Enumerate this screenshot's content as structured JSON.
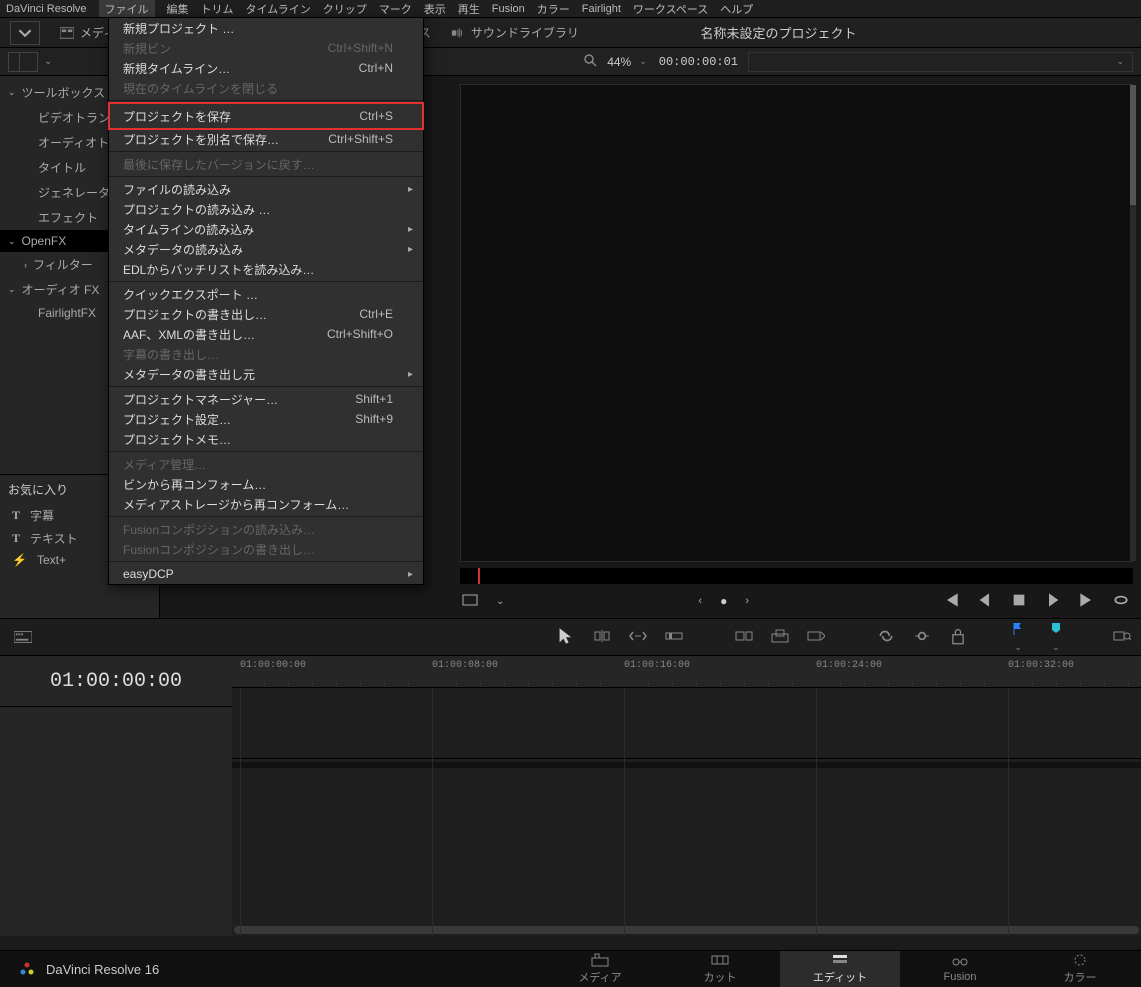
{
  "app_name": "DaVinci Resolve",
  "menus": [
    "ファイル",
    "編集",
    "トリム",
    "タイムライン",
    "クリップ",
    "マーク",
    "表示",
    "再生",
    "Fusion",
    "カラー",
    "Fairlight",
    "ワークスペース",
    "ヘルプ"
  ],
  "active_menu_index": 0,
  "toolbar": {
    "media_pool": "メディ",
    "effects_library": "ックス",
    "sound_library": "サウンドライブラリ"
  },
  "project_title": "名称未設定のプロジェクト",
  "viewer": {
    "zoom": "44%",
    "timecode": "00:00:00:01"
  },
  "sidebar": {
    "toolbox": "ツールボックス",
    "items": [
      "ビデオトランジ",
      "オーディオトラ",
      "タイトル",
      "ジェネレーター",
      "エフェクト"
    ],
    "openfx": "OpenFX",
    "filter": "フィルター",
    "audiofx": "オーディオ FX",
    "fairlightfx": "FairlightFX",
    "favorites": "お気に入り",
    "fav_items": [
      "字幕",
      "テキスト",
      "Text+"
    ]
  },
  "file_menu": {
    "items": [
      {
        "label": "新規プロジェクト …",
        "shortcut": "",
        "type": "item"
      },
      {
        "label": "新規ビン",
        "shortcut": "Ctrl+Shift+N",
        "type": "disabled"
      },
      {
        "label": "新規タイムライン…",
        "shortcut": "Ctrl+N",
        "type": "item"
      },
      {
        "label": "現在のタイムラインを閉じる",
        "shortcut": "",
        "type": "disabled"
      },
      {
        "type": "sep"
      },
      {
        "label": "プロジェクトを保存",
        "shortcut": "Ctrl+S",
        "type": "highlight"
      },
      {
        "label": "プロジェクトを別名で保存…",
        "shortcut": "Ctrl+Shift+S",
        "type": "item"
      },
      {
        "type": "sep"
      },
      {
        "label": "最後に保存したバージョンに戻す…",
        "shortcut": "",
        "type": "disabled"
      },
      {
        "type": "sep"
      },
      {
        "label": "ファイルの読み込み",
        "shortcut": "",
        "type": "sub"
      },
      {
        "label": "プロジェクトの読み込み …",
        "shortcut": "",
        "type": "item"
      },
      {
        "label": "タイムラインの読み込み",
        "shortcut": "",
        "type": "sub"
      },
      {
        "label": "メタデータの読み込み",
        "shortcut": "",
        "type": "sub"
      },
      {
        "label": "EDLからバッチリストを読み込み…",
        "shortcut": "",
        "type": "item"
      },
      {
        "type": "sep"
      },
      {
        "label": "クイックエクスポート …",
        "shortcut": "",
        "type": "item"
      },
      {
        "label": "プロジェクトの書き出し…",
        "shortcut": "Ctrl+E",
        "type": "item"
      },
      {
        "label": "AAF、XMLの書き出し…",
        "shortcut": "Ctrl+Shift+O",
        "type": "item"
      },
      {
        "label": "字幕の書き出し…",
        "shortcut": "",
        "type": "disabled"
      },
      {
        "label": "メタデータの書き出し元",
        "shortcut": "",
        "type": "sub"
      },
      {
        "type": "sep"
      },
      {
        "label": "プロジェクトマネージャー…",
        "shortcut": "Shift+1",
        "type": "item"
      },
      {
        "label": "プロジェクト設定…",
        "shortcut": "Shift+9",
        "type": "item"
      },
      {
        "label": "プロジェクトメモ…",
        "shortcut": "",
        "type": "item"
      },
      {
        "type": "sep"
      },
      {
        "label": "メディア管理…",
        "shortcut": "",
        "type": "disabled"
      },
      {
        "label": "ビンから再コンフォーム…",
        "shortcut": "",
        "type": "item"
      },
      {
        "label": "メディアストレージから再コンフォーム…",
        "shortcut": "",
        "type": "item"
      },
      {
        "type": "sep"
      },
      {
        "label": "Fusionコンポジションの読み込み…",
        "shortcut": "",
        "type": "disabled"
      },
      {
        "label": "Fusionコンポジションの書き出し…",
        "shortcut": "",
        "type": "disabled"
      },
      {
        "type": "sep"
      },
      {
        "label": "easyDCP",
        "shortcut": "",
        "type": "sub"
      }
    ]
  },
  "timeline": {
    "playhead_tc": "01:00:00:00",
    "ticks": [
      "01:00:00:00",
      "01:00:08:00",
      "01:00:16:00",
      "01:00:24:00",
      "01:00:32:00"
    ]
  },
  "bottom": {
    "app_label": "DaVinci Resolve 16",
    "pages": [
      "メディア",
      "カット",
      "エディット",
      "Fusion",
      "カラー"
    ],
    "active_page_index": 2
  }
}
